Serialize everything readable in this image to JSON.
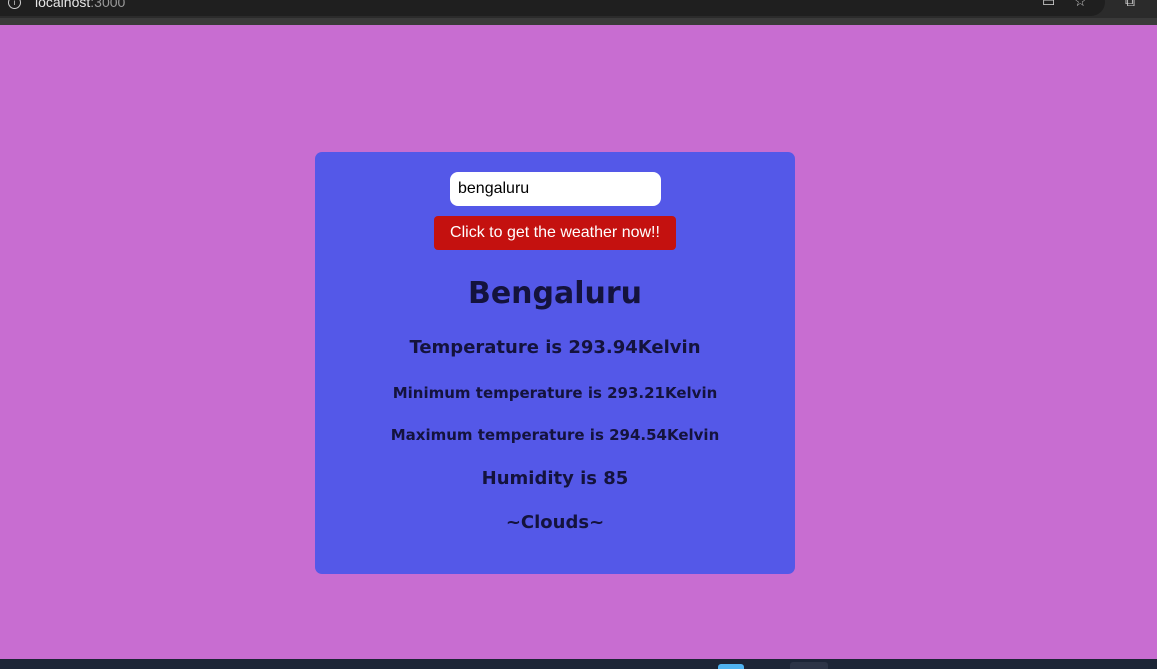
{
  "browser": {
    "url_host": "localhost",
    "url_port": ":3000",
    "info_icon": "info-icon",
    "icons": [
      "cast-icon",
      "star-icon",
      "extensions-icon"
    ]
  },
  "form": {
    "city_value": "bengaluru",
    "button_label": "Click to get the weather now!!"
  },
  "weather": {
    "city": "Bengaluru",
    "temperature": "Temperature is 293.94Kelvin",
    "min_temperature": "Minimum temperature is 293.21Kelvin",
    "max_temperature": "Maximum temperature is 294.54Kelvin",
    "humidity": "Humidity is 85",
    "condition": "~Clouds~"
  },
  "colors": {
    "page_background": "#c86dd1",
    "card_background": "#5458e8",
    "button_background": "#c4110f",
    "text_color": "#14133d"
  }
}
